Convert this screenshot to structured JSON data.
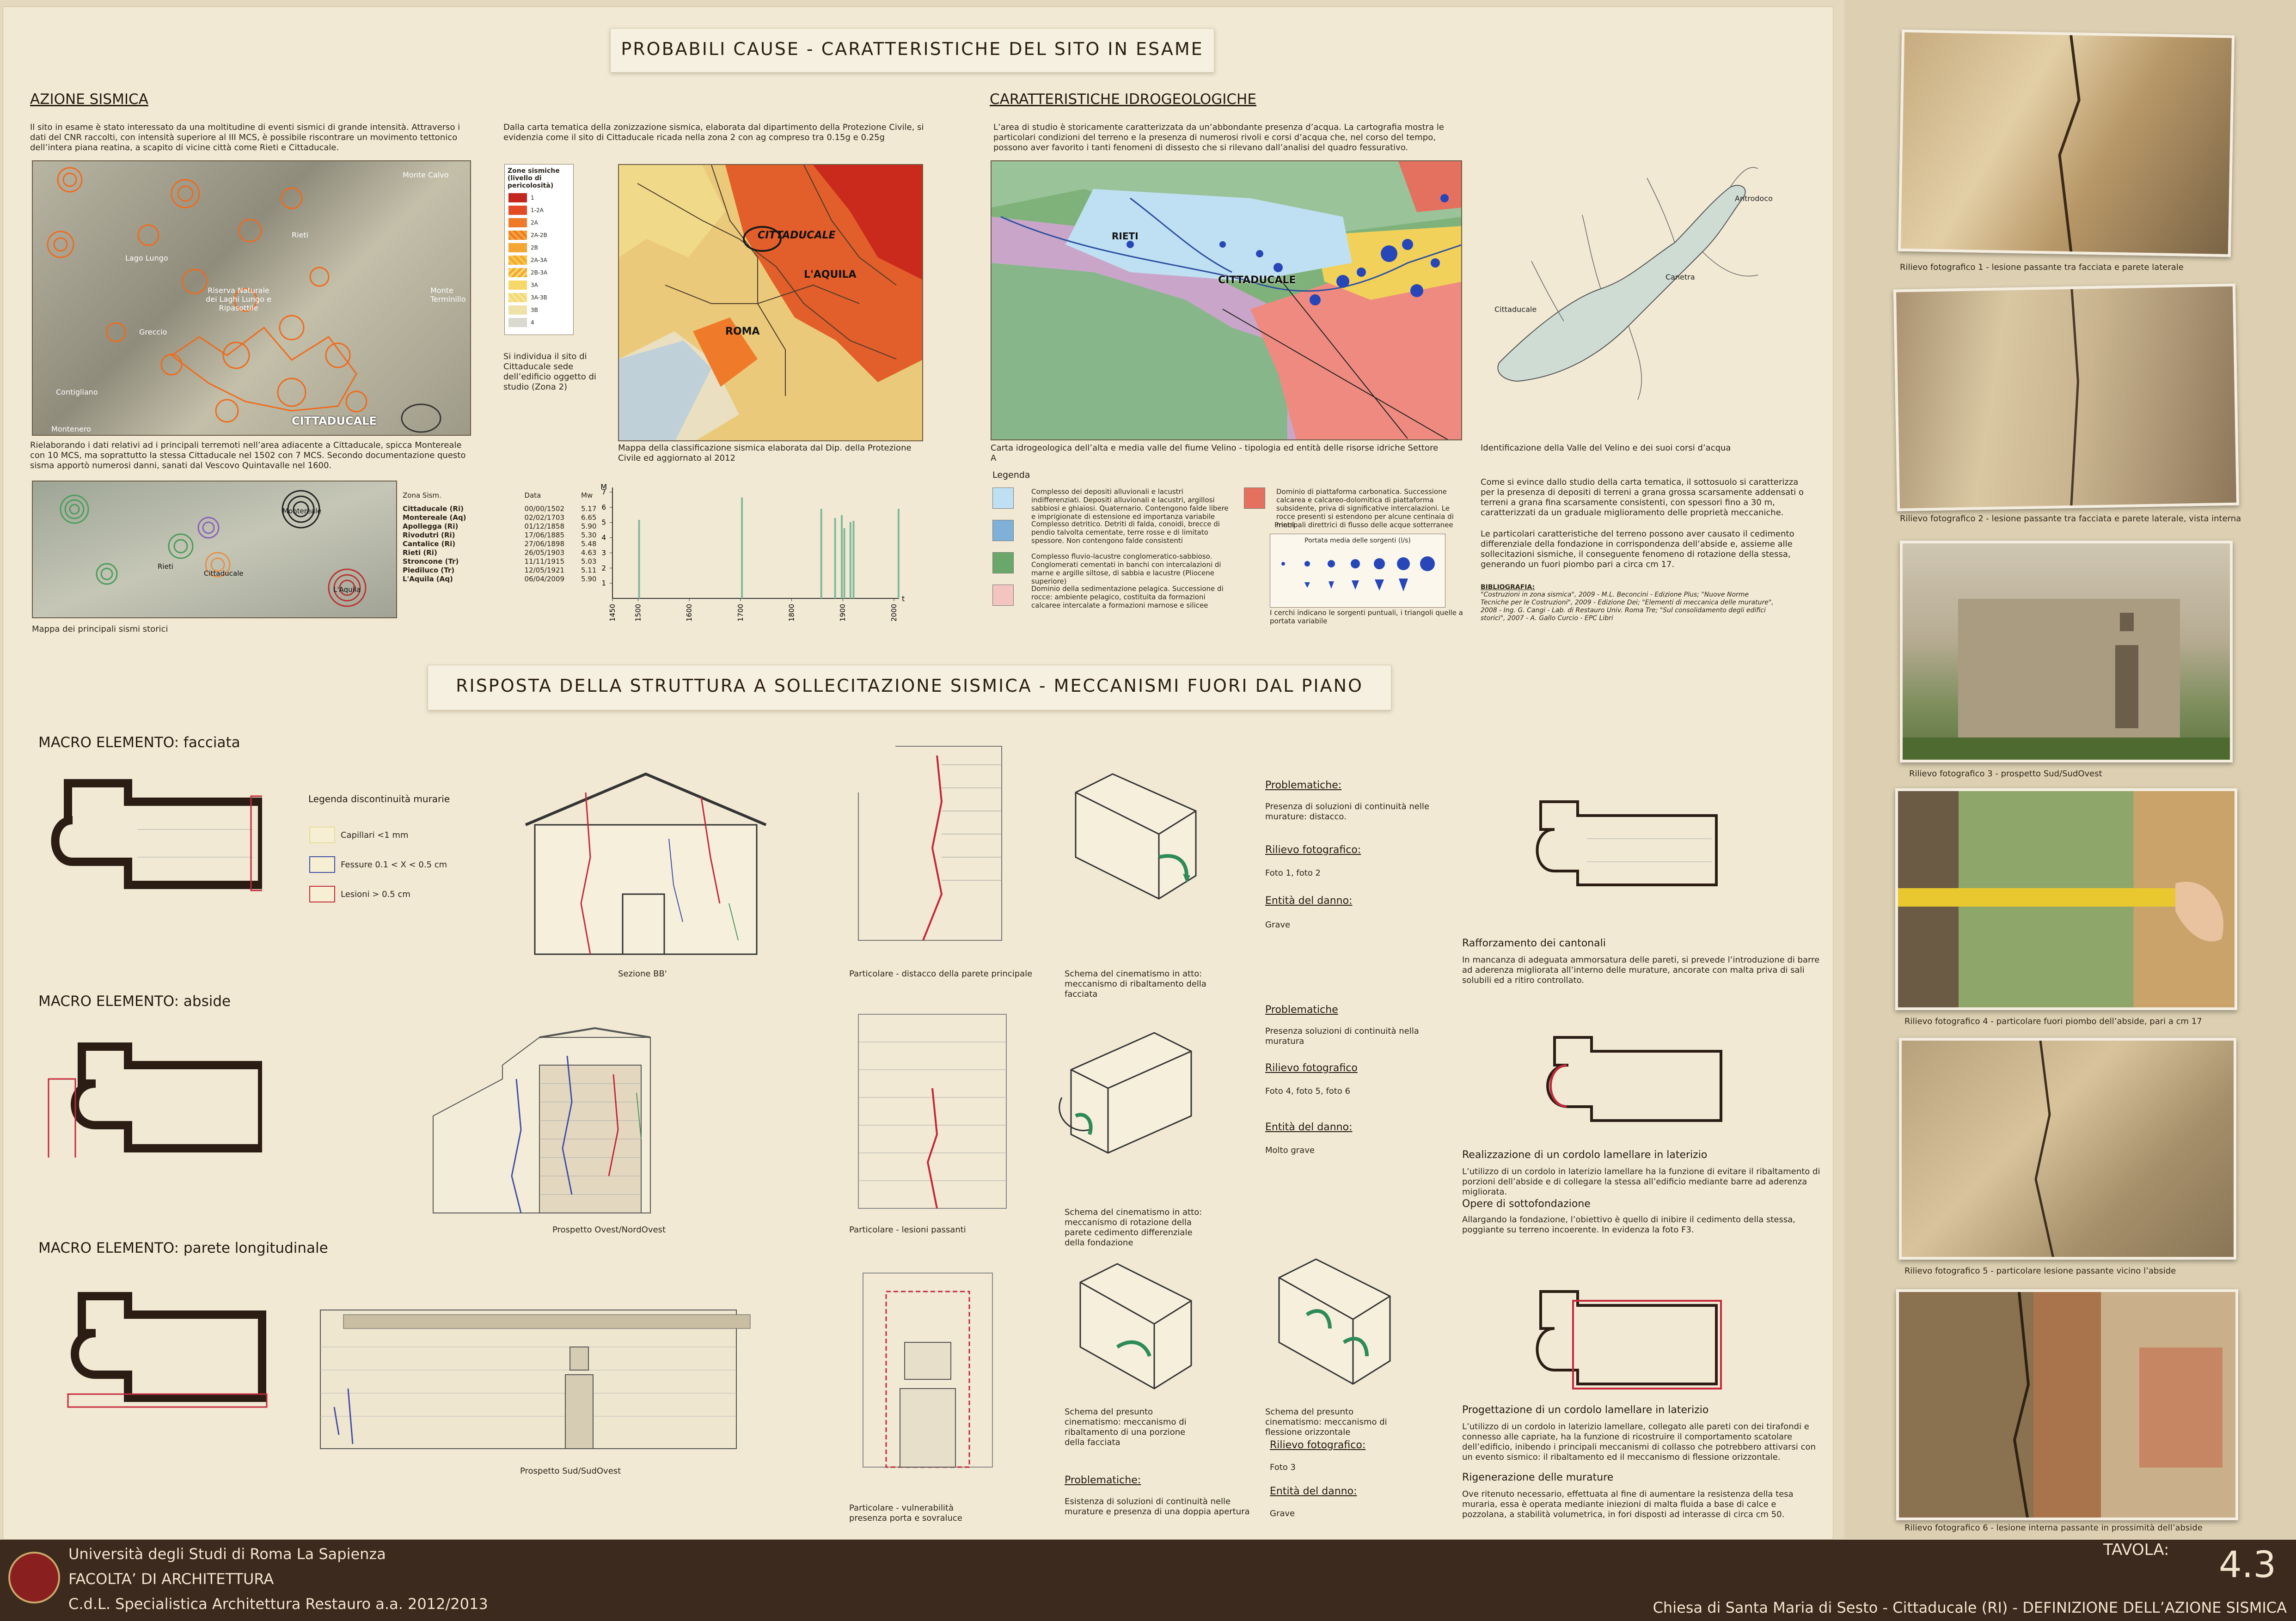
{
  "header": {
    "title_1": "PROBABILI CAUSE - CARATTERISTICHE DEL SITO IN ESAME",
    "title_2": "RISPOSTA DELLA STRUTTURA A SOLLECITAZIONE SISMICA - MECCANISMI FUORI DAL PIANO"
  },
  "azione": {
    "heading": "AZIONE SISMICA",
    "intro": "Il sito in esame è stato interessato da una moltitudine di eventi sismici di grande intensità. Attraverso i dati del CNR raccolti, con intensità superiore al III MCS, è possibile riscontrare un movimento tettonico dell’intera piana reatina, a scapito di vicine città come Rieti e Cittaducale.",
    "map_labels": [
      "Monte Calvo",
      "Rieti",
      "Lago Lungo",
      "Riserva Naturale dei Laghi Lungo e Ripasottile",
      "Greccio",
      "Contigliano",
      "Monte Terminillo",
      "Cittaducale",
      "Montenero"
    ],
    "map_city": "CITTADUCALE",
    "after_map": "Rielaborando i dati relativi ad i principali terremoti nell’area adiacente a Cittaducale, spicca Montereale con 10 MCS, ma soprattutto la stessa Cittaducale nel 1502 con 7 MCS. Secondo documentazione questo sisma apportò numerosi danni, sanati dal Vescovo Quintavalle nel 1600.",
    "zonation_text": "Dalla carta tematica della zonizzazione sismica, elaborata dal dipartimento della Protezione Civile, si evidenzia come il sito di Cittaducale ricada nella zona 2 con ag compreso tra 0.15g e 0.25g",
    "zone_legend_title": "Zone sismiche (livello di pericolosità)",
    "zone_legend_items": [
      "1",
      "1-2A",
      "2A",
      "2A-2B",
      "2B",
      "2A-3A",
      "2B-3A",
      "3A",
      "3A-3B",
      "3B",
      "4"
    ],
    "zone_note": "Si individua il sito di Cittaducale sede dell’edificio oggetto di studio (Zona 2)",
    "zone_map_labels": [
      "CITTADUCALE",
      "L'AQUILA",
      "ROMA"
    ],
    "zone_map_caption": "Mappa della classificazione sismica elaborata dal Dip. della Protezione Civile ed aggiornato al 2012",
    "hist_map_caption": "Mappa dei principali sismi storici",
    "hist_map_labels": [
      "Montereale",
      "Rieti",
      "Cittaducale",
      "L'Aquila"
    ],
    "table_headers": [
      "Zona Sism.",
      "Data",
      "Mw"
    ],
    "table_rows": [
      [
        "Cittaducale (Ri)",
        "00/00/1502",
        "5.17"
      ],
      [
        "Montereale (Aq)",
        "02/02/1703",
        "6.65"
      ],
      [
        "Apollegga (Ri)",
        "01/12/1858",
        "5.90"
      ],
      [
        "Rivodutri (Ri)",
        "17/06/1885",
        "5.30"
      ],
      [
        "Cantalice (Ri)",
        "27/06/1898",
        "5.48"
      ],
      [
        "Rieti (Ri)",
        "26/05/1903",
        "4.63"
      ],
      [
        "Stroncone (Tr)",
        "11/11/1915",
        "5.03"
      ],
      [
        "Piediluco (Tr)",
        "12/05/1921",
        "5.11"
      ],
      [
        "L'Aquila (Aq)",
        "06/04/2009",
        "5.90"
      ]
    ]
  },
  "chart_data": {
    "type": "bar",
    "title": "",
    "xlabel": "t",
    "ylabel": "M",
    "ylim": [
      0,
      7
    ],
    "xlim": [
      1450,
      2010
    ],
    "yticks": [
      1,
      2,
      3,
      4,
      5,
      6,
      7
    ],
    "xticks": [
      1450,
      1500,
      1600,
      1700,
      1800,
      1900,
      2000
    ],
    "x": [
      1502,
      1703,
      1858,
      1885,
      1898,
      1903,
      1915,
      1921,
      2009
    ],
    "values": [
      5.17,
      6.65,
      5.9,
      5.3,
      5.48,
      4.63,
      5.03,
      5.11,
      5.9
    ],
    "color": "#7fb89a"
  },
  "idro": {
    "heading": "CARATTERISTICHE IDROGEOLOGICHE",
    "intro": "L’area di studio è storicamente caratterizzata da un’abbondante presenza d’acqua. La cartografia mostra le particolari condizioni del terreno e la presenza di numerosi rivoli e corsi d’acqua che, nel corso del tempo, possono aver favorito i tanti fenomeni di dissesto che si rilevano dall’analisi del quadro fessurativo.",
    "map_labels": [
      "RIETI",
      "CITTADUCALE"
    ],
    "map_caption": "Carta idrogeologica dell’alta e media valle del fiume Velino - tipologia ed entità delle risorse idriche Settore A",
    "valley_caption": "Identificazione della Valle del Velino e dei suoi corsi d’acqua",
    "valley_labels": [
      "Antrodoco",
      "Canetra",
      "Cittaducale"
    ],
    "legend_title": "Legenda",
    "legend": [
      {
        "color": "#bfe0f2",
        "text": "Complesso dei depositi alluvionali e lacustri indifferenziati. Depositi alluvionali e lacustri, argillosi sabbiosi e ghiaiosi. Quaternario. Contengono falde libere e imprigionate di estensione ed importanza variabile"
      },
      {
        "color": "#7fb0d8",
        "text": "Complesso detritico. Detriti di falda, conoidi, brecce di pendio talvolta cementate, terre rosse e di limitato spessore. Non contengono falde consistenti"
      },
      {
        "color": "#69a86a",
        "text": "Complesso fluvio-lacustre conglomeratico-sabbioso. Conglomerati cementati in banchi con intercalazioni di marne e argille siltose, di sabbia e lacustre (Pliocene superiore)"
      },
      {
        "color": "#f3c4c0",
        "text": "Dominio della sedimentazione pelagica. Successione di rocce: ambiente pelagico, costituita da formazioni calcaree intercalate a formazioni marnose e silicee"
      },
      {
        "color": "#e4705f",
        "text": "Dominio di piattaforma carbonatica. Successione calcarea e calcareo-dolomitica di piattaforma subsidente, priva di significative intercalazioni. Le rocce presenti si estendono per alcune centinaia di metri"
      }
    ],
    "flow_label": "Principali direttrici di flusso delle acque sotterranee",
    "portata_title": "Portata media delle sorgenti (l/s)",
    "portata_note": "I cerchi indicano le sorgenti puntuali, i triangoli quelle a portata variabile",
    "conclusion_1": "Come si evince dallo studio della carta tematica, il sottosuolo si caratterizza per la presenza di depositi di terreni a grana grossa scarsamente addensati o terreni a grana fina scarsamente consistenti, con spessori fino a 30 m, caratterizzati da un graduale miglioramento delle proprietà meccaniche.",
    "conclusion_2": "Le particolari caratteristiche del terreno possono aver causato il cedimento differenziale della fondazione in corrispondenza dell’abside e, assieme alle sollecitazioni sismiche, il conseguente fenomeno di rotazione della stessa, generando un fuori piombo pari a circa cm 17.",
    "biblio_title": "BIBLIOGRAFIA:",
    "biblio": "\"Costruzioni in zona sismica\", 2009 - M.L. Beconcini - Edizione Plus; \"Nuove Norme Tecniche per le Costruzioni\", 2009 - Edizione Dei; \"Elementi di meccanica delle murature\", 2008 - Ing. G. Cangi - Lab. di Restauro Univ. Roma Tre; \"Sul consolidamento degli edifici storici\", 2007 - A. Gallo Curcio - EPC Libri"
  },
  "macro": [
    {
      "title": "MACRO ELEMENTO: facciata",
      "elev_caption": "Sezione BB'",
      "detail_caption": "Particolare - distacco della parete principale",
      "schema_caption": "Schema del cinematismo in atto: meccanismo di ribaltamento della facciata",
      "problem_h": "Problematiche:",
      "problem": "Presenza di soluzioni di continuità nelle murature: distacco.",
      "rilievo_h": "Rilievo fotografico:",
      "rilievo": "Foto 1, foto 2",
      "danno_h": "Entità del danno:",
      "danno": "Grave"
    },
    {
      "title": "MACRO ELEMENTO: abside",
      "elev_caption": "Prospetto Ovest/NordOvest",
      "detail_caption": "Particolare - lesioni passanti",
      "schema_caption": "Schema del cinematismo in atto: meccanismo di rotazione della parete cedimento differenziale della fondazione",
      "problem_h": "Problematiche",
      "problem": "Presenza soluzioni di continuità nella muratura",
      "rilievo_h": "Rilievo fotografico",
      "rilievo": "Foto 4, foto 5, foto 6",
      "danno_h": "Entità del danno:",
      "danno": "Molto grave"
    },
    {
      "title": "MACRO ELEMENTO: parete longitudinale",
      "elev_caption": "Prospetto Sud/SudOvest",
      "detail_caption": "Particolare - vulnerabilità presenza porta e sovraluce",
      "schema_caption": "Schema del presunto cinematismo: meccanismo di ribaltamento di una porzione della facciata",
      "schema_caption_2": "Schema del presunto cinematismo: meccanismo di flessione orizzontale",
      "problem_h": "Problematiche:",
      "problem": "Esistenza di soluzioni di continuità nelle murature e presenza di una doppia apertura",
      "rilievo_h": "Rilievo fotografico:",
      "rilievo": "Foto 3",
      "danno_h": "Entità del danno:",
      "danno": "Grave"
    }
  ],
  "legend_disc": {
    "title": "Legenda discontinuità murarie",
    "items": [
      {
        "color": "#e8dc9a",
        "label": "Capillari <1 mm"
      },
      {
        "color": "#3f4fa6",
        "label": "Fessure 0.1 < X < 0.5 cm"
      },
      {
        "color": "#c4283a",
        "label": "Lesioni > 0.5 cm"
      }
    ]
  },
  "interventi": [
    {
      "title": "Rafforzamento dei cantonali",
      "text": "In mancanza di adeguata ammorsatura delle pareti, si prevede l’introduzione di barre ad aderenza migliorata all’interno delle murature, ancorate con malta priva di sali solubili ed a ritiro controllato."
    },
    {
      "title": "Realizzazione di un cordolo lamellare in laterizio",
      "text": "L’utilizzo di un cordolo in laterizio lamellare ha la funzione di evitare il ribaltamento di porzioni dell’abside e di collegare la stessa all’edificio mediante barre ad aderenza migliorata."
    },
    {
      "title": "Opere di sottofondazione",
      "text": "Allargando la fondazione, l’obiettivo è quello di inibire il cedimento della stessa, poggiante su terreno incoerente. In evidenza la foto F3."
    },
    {
      "title": "Progettazione di un cordolo lamellare in laterizio",
      "text": "L’utilizzo di un cordolo in laterizio lamellare, collegato alle pareti con dei tirafondi e connesso alle capriate, ha la funzione di ricostruire il comportamento scatolare dell’edificio, inibendo i principali meccanismi di collasso che potrebbero attivarsi con un evento sismico: il ribaltamento ed il meccanismo di flessione orizzontale."
    },
    {
      "title": "Rigenerazione delle murature",
      "text": "Ove ritenuto necessario, effettuata al fine di aumentare la resistenza della tesa muraria, essa è operata mediante iniezioni di malta fluida a base di calce e pozzolana, a stabilità volumetrica, in fori disposti ad interasse di circa cm 50."
    }
  ],
  "photos": [
    "Rilievo fotografico 1 - lesione passante tra facciata e parete laterale",
    "Rilievo fotografico 2 - lesione passante tra facciata e parete laterale, vista interna",
    "Rilievo fotografico  3 - prospetto Sud/SudOvest",
    "Rilievo fotografico 4 - particolare fuori piombo dell’abside, pari a cm 17",
    "Rilievo fotografico 5 - particolare lesione passante vicino l’abside",
    "Rilievo fotografico 6 - lesione interna passante in prossimità dell’abside"
  ],
  "footer": {
    "uni": "Università degli Studi di Roma La Sapienza",
    "fac": "FACOLTA’ DI ARCHITETTURA",
    "course": "C.d.L. Specialistica Architettura Restauro a.a. 2012/2013",
    "tavola_label": "TAVOLA:",
    "tavola_num": "4.3",
    "project": "Chiesa di Santa Maria di Sesto - Cittaducale (RI) - DEFINIZIONE DELL’AZIONE SISMICA"
  },
  "colors": {
    "paper": "#f1e9d4",
    "footer": "#3b2a1d",
    "accent_red": "#c4283a",
    "accent_green": "#2e8b57"
  }
}
